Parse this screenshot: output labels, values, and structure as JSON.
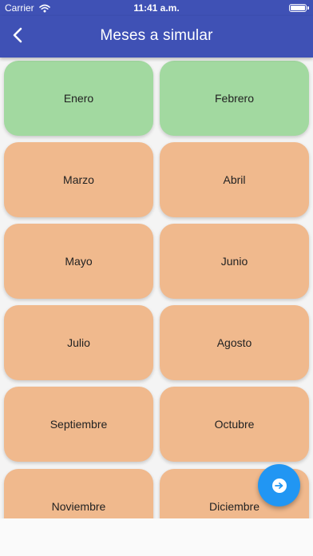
{
  "status_bar": {
    "carrier": "Carrier",
    "time": "11:41 a.m."
  },
  "header": {
    "title": "Meses a simular",
    "back_icon": "chevron-left-icon"
  },
  "months": [
    {
      "label": "Enero",
      "state": "done"
    },
    {
      "label": "Febrero",
      "state": "done"
    },
    {
      "label": "Marzo",
      "state": "pending"
    },
    {
      "label": "Abril",
      "state": "pending"
    },
    {
      "label": "Mayo",
      "state": "pending"
    },
    {
      "label": "Junio",
      "state": "pending"
    },
    {
      "label": "Julio",
      "state": "pending"
    },
    {
      "label": "Agosto",
      "state": "pending"
    },
    {
      "label": "Septiembre",
      "state": "pending"
    },
    {
      "label": "Octubre",
      "state": "pending"
    },
    {
      "label": "Noviembre",
      "state": "pending"
    },
    {
      "label": "Diciembre",
      "state": "pending"
    }
  ],
  "colors": {
    "app_bar": "#3f51b5",
    "done": "#a2d9a0",
    "pending": "#f0b98d",
    "fab": "#2196f3"
  },
  "fab": {
    "icon": "arrow-right-circle-icon"
  }
}
